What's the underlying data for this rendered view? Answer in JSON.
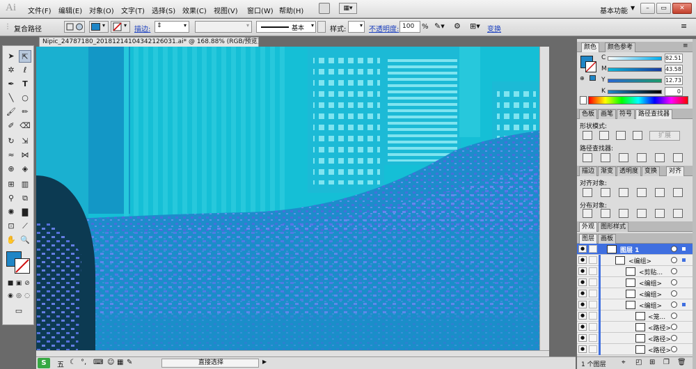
{
  "app": {
    "logo": "Ai"
  },
  "menu": {
    "items": [
      "文件(F)",
      "编辑(E)",
      "对象(O)",
      "文字(T)",
      "选择(S)",
      "效果(C)",
      "视图(V)",
      "窗口(W)",
      "帮助(H)"
    ],
    "workspace": "基本功能",
    "workspace_arrow": "▼"
  },
  "control_bar": {
    "selection_label": "复合路径",
    "stroke_link": "描边:",
    "stroke_profile": "基本",
    "style_label": "样式:",
    "opacity_link": "不透明度:",
    "opacity_value": "100",
    "opacity_unit": "%",
    "transform_link": "变换"
  },
  "document": {
    "tab_title": "Nipic_24787180_20181214104342126031.ai* @ 168.88% (RGB/预览)",
    "close": "×"
  },
  "status_bar": {
    "ime_badge": "S",
    "ime_mode": "五",
    "tool_name": "直接选择",
    "arrow": "▶"
  },
  "color_panel": {
    "tabs": [
      "颜色",
      "颜色参考"
    ],
    "channels": [
      {
        "label": "C",
        "value": "82.51"
      },
      {
        "label": "M",
        "value": "43.58"
      },
      {
        "label": "Y",
        "value": "12.73"
      },
      {
        "label": "K",
        "value": "0"
      }
    ],
    "fill_color": "#1f86c6"
  },
  "pathfinder_panel": {
    "tabs": [
      "色板",
      "画笔",
      "符号",
      "路径查找器"
    ],
    "shape_modes_label": "形状模式:",
    "pathfinders_label": "路径查找器:",
    "expand_label": "扩展"
  },
  "align_panel": {
    "tabs": [
      "描边",
      "渐变",
      "透明度",
      "变换",
      "对齐"
    ],
    "align_objects_label": "对齐对象:",
    "distribute_label": "分布对象:"
  },
  "appearance_panel": {
    "tabs": [
      "外观",
      "图形样式"
    ]
  },
  "layers_panel": {
    "tabs": [
      "图层",
      "画板"
    ],
    "rows": [
      {
        "name": "图层 1",
        "indent": 0,
        "highlight": true
      },
      {
        "name": "<编组>",
        "indent": 1
      },
      {
        "name": "<剪贴...",
        "indent": 2
      },
      {
        "name": "<编组>",
        "indent": 2
      },
      {
        "name": "<编组>",
        "indent": 2
      },
      {
        "name": "<编组>",
        "indent": 2
      },
      {
        "name": "<笼...",
        "indent": 3
      },
      {
        "name": "<路径>",
        "indent": 3
      },
      {
        "name": "<路径>",
        "indent": 3
      },
      {
        "name": "<路径>",
        "indent": 3
      }
    ],
    "footer": "1 个图层"
  }
}
